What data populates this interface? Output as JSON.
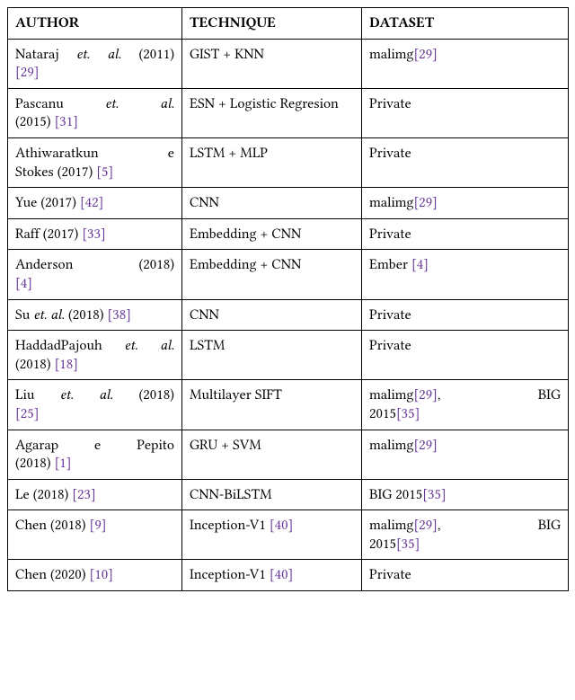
{
  "headers": {
    "author": "AUTHOR",
    "technique": "TECHNIQUE",
    "dataset": "DATASET"
  },
  "rows": [
    {
      "a_pre": "Nataraj ",
      "a_it": "et. al.",
      "a_post": " (2011)",
      "a_ref": "[29]",
      "a_two_line": true,
      "a_second_plain": "",
      "t": "GIST + KNN",
      "d_text1": "malimg",
      "d_ref1": "[29]",
      "d_text2": "",
      "d_ref2": "",
      "d_wide": false
    },
    {
      "a_pre": "Pascanu ",
      "a_it": "et. al.",
      "a_post": "",
      "a_ref": "[31]",
      "a_two_line": true,
      "a_second_plain": "(2015) ",
      "t": "ESN + Logistic Regresion",
      "d_text1": "Private",
      "d_ref1": "",
      "d_text2": "",
      "d_ref2": "",
      "d_wide": false
    },
    {
      "a_pre": "Athiwaratkun e",
      "a_it": "",
      "a_post": "",
      "a_ref": "[5]",
      "a_two_line": true,
      "a_second_plain": "Stokes (2017) ",
      "t": "LSTM + MLP",
      "d_text1": "Private",
      "d_ref1": "",
      "d_text2": "",
      "d_ref2": "",
      "d_wide": false
    },
    {
      "a_pre": "Yue (2017) ",
      "a_it": "",
      "a_post": "",
      "a_ref": "[42]",
      "a_two_line": false,
      "a_second_plain": "",
      "t": "CNN",
      "d_text1": "malimg",
      "d_ref1": "[29]",
      "d_text2": "",
      "d_ref2": "",
      "d_wide": false
    },
    {
      "a_pre": "Raff (2017) ",
      "a_it": "",
      "a_post": "",
      "a_ref": "[33]",
      "a_two_line": false,
      "a_second_plain": "",
      "t": "Embedding + CNN",
      "d_text1": "Private",
      "d_ref1": "",
      "d_text2": "",
      "d_ref2": "",
      "d_wide": false
    },
    {
      "a_pre": "Anderson (2018)",
      "a_it": "",
      "a_post": "",
      "a_ref": "[4]",
      "a_two_line": true,
      "a_second_plain": "",
      "t": "Embedding + CNN",
      "d_text1": "Ember ",
      "d_ref1": "[4]",
      "d_text2": "",
      "d_ref2": "",
      "d_wide": false
    },
    {
      "a_pre": "Su ",
      "a_it": "et. al.",
      "a_post": " (2018) ",
      "a_ref": "[38]",
      "a_two_line": false,
      "a_second_plain": "",
      "t": "CNN",
      "d_text1": "Private",
      "d_ref1": "",
      "d_text2": "",
      "d_ref2": "",
      "d_wide": false
    },
    {
      "a_pre": "HaddadPajouh ",
      "a_it": "et. al.",
      "a_post": "",
      "a_ref": "[18]",
      "a_two_line": true,
      "a_second_plain_pre": "",
      "a_second_it": true,
      "a_second_it_text": "",
      "a_second_plain": " (2018) ",
      "a_it_on_line2": false,
      "t": "LSTM",
      "d_text1": "Private",
      "d_ref1": "",
      "d_text2": "",
      "d_ref2": "",
      "d_wide": false
    },
    {
      "a_pre": "Liu ",
      "a_it": "et. al.",
      "a_post": " (2018)",
      "a_ref": "[25]",
      "a_two_line": true,
      "a_second_plain": "",
      "t": "Multilayer SIFT",
      "d_text1": "malimg",
      "d_ref1": "[29]",
      "d_text2": ", BIG 2015",
      "d_ref2": "[35]",
      "d_wide": true
    },
    {
      "a_pre": "Agarap e Pepito",
      "a_it": "",
      "a_post": "",
      "a_ref": "[1]",
      "a_two_line": true,
      "a_second_plain": "(2018) ",
      "t": "GRU + SVM",
      "d_text1": "malimg",
      "d_ref1": "[29]",
      "d_text2": "",
      "d_ref2": "",
      "d_wide": false
    },
    {
      "a_pre": "Le (2018) ",
      "a_it": "",
      "a_post": "",
      "a_ref": "[23]",
      "a_two_line": false,
      "a_second_plain": "",
      "t": "CNN-BiLSTM",
      "d_text1": "BIG 2015",
      "d_ref1": "[35]",
      "d_text2": "",
      "d_ref2": "",
      "d_wide": false
    },
    {
      "a_pre": "Chen (2018) ",
      "a_it": "",
      "a_post": "",
      "a_ref": "[9]",
      "a_two_line": false,
      "a_second_plain": "",
      "t": "Inception-V1 ",
      "t_ref": "[40]",
      "d_text1": "malimg",
      "d_ref1": "[29]",
      "d_text2": ", BIG 2015",
      "d_ref2": "[35]",
      "d_wide": true
    },
    {
      "a_pre": "Chen (2020) ",
      "a_it": "",
      "a_post": "",
      "a_ref": "[10]",
      "a_two_line": false,
      "a_second_plain": "",
      "t": "Inception-V1 ",
      "t_ref": "[40]",
      "d_text1": "Private",
      "d_ref1": "",
      "d_text2": "",
      "d_ref2": "",
      "d_wide": false
    }
  ]
}
